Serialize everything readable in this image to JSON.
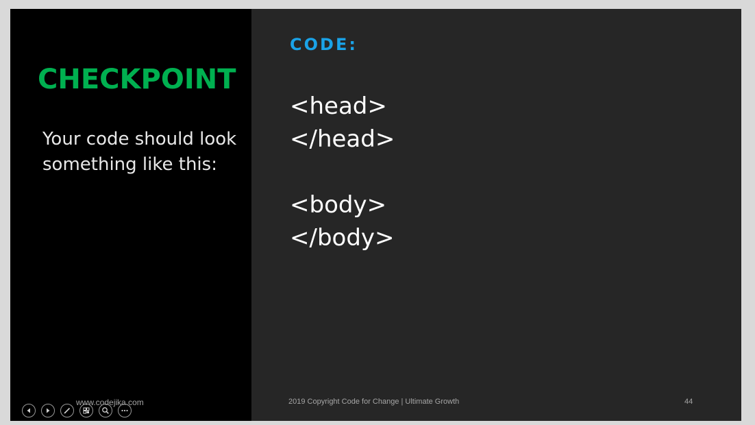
{
  "slide": {
    "title": "CHECKPOINT",
    "subtext": "Your code should look something like this:",
    "code_label": "CODE:",
    "code_lines": [
      "<head>",
      "</head>",
      "",
      "<body>",
      "</body>"
    ],
    "footer_left": "www.codejika.com",
    "footer_center": "2019 Copyright Code for Change | Ultimate Growth",
    "page_number": "44"
  },
  "colors": {
    "title": "#00b050",
    "code_label": "#1aa3e8",
    "left_panel_bg": "#000000",
    "right_panel_bg": "#262626",
    "frame": "#d9d9d9"
  },
  "controls": [
    {
      "icon": "previous-slide-icon"
    },
    {
      "icon": "next-slide-icon"
    },
    {
      "icon": "pen-icon"
    },
    {
      "icon": "slide-overview-icon"
    },
    {
      "icon": "zoom-icon"
    },
    {
      "icon": "more-options-icon"
    }
  ]
}
